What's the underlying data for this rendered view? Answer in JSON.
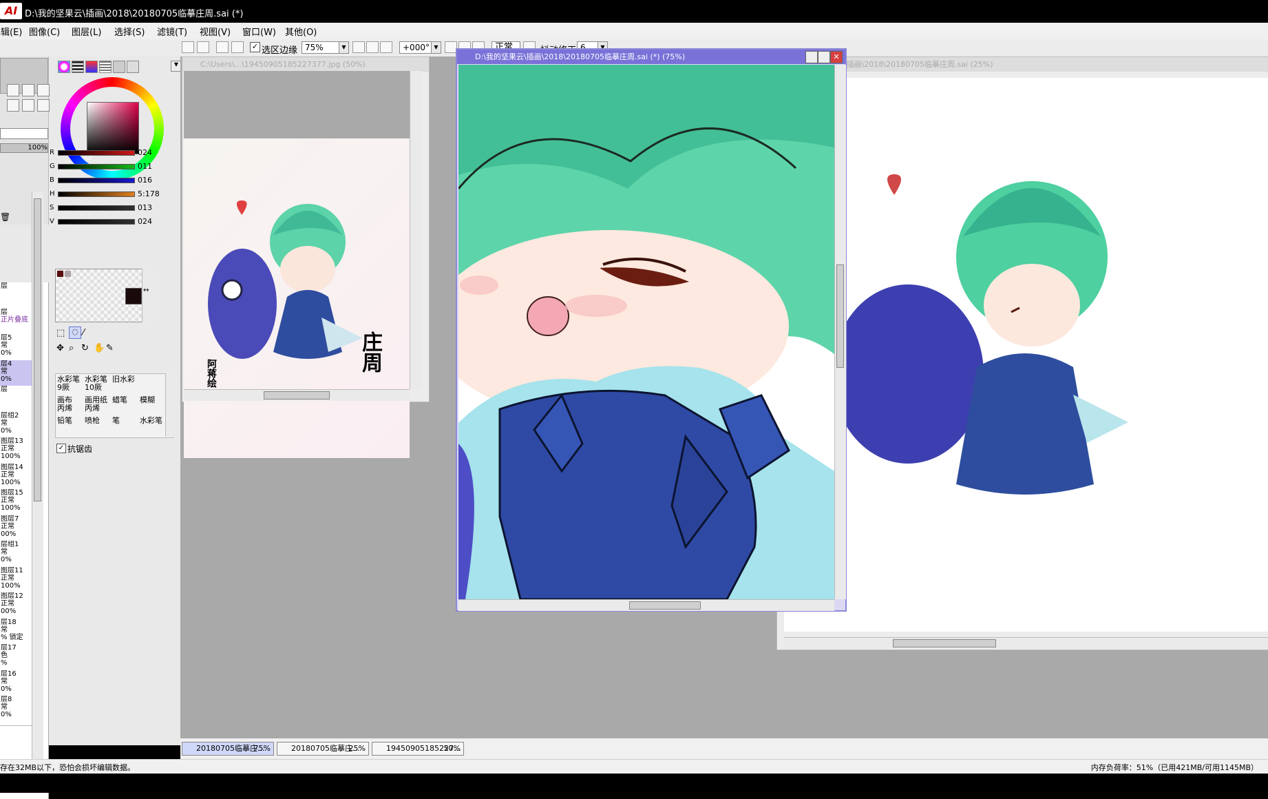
{
  "window": {
    "logo": "AI",
    "title": "D:\\我的坚果云\\插画\\2018\\20180705临摹庄周.sai (*)"
  },
  "menu": [
    "编辑(E)",
    "图像(C)",
    "图层(L)",
    "选择(S)",
    "滤镜(T)",
    "视图(V)",
    "窗口(W)",
    "其他(O)"
  ],
  "toolbar": {
    "selection_edge_label": "选区边缘",
    "zoom": "75%",
    "rotation": "+000°",
    "blend_mode": "正常",
    "stabilizer_label": "抖动修正",
    "stabilizer_value": "6"
  },
  "color_panel": {
    "current_color": "#1a0a0c",
    "sliders": [
      {
        "label": "R",
        "value": "024",
        "color": "#d01818"
      },
      {
        "label": "G",
        "value": "011",
        "color": "#18b818"
      },
      {
        "label": "B",
        "value": "016",
        "color": "#1818d0"
      },
      {
        "label": "H",
        "value": "5:178",
        "color": "#e08020"
      },
      {
        "label": "S",
        "value": "013",
        "color": "#303030"
      },
      {
        "label": "V",
        "value": "024",
        "color": "#303030"
      }
    ],
    "opacity": "100%"
  },
  "brushes": [
    [
      "水彩笔\n9厥",
      "水彩笔\n10厥",
      "旧水彩"
    ],
    [
      "画布\n丙烯",
      "画用纸\n丙烯",
      "蜡笔",
      "模糊"
    ],
    [
      "铅笔",
      "喷枪",
      "笔",
      "水彩笔"
    ]
  ],
  "antialias_label": "抗锯齿",
  "layers": [
    {
      "name": "层",
      "mode": "",
      "opacity": ""
    },
    {
      "name": "层",
      "mode": "正片叠底",
      "opacity": ""
    },
    {
      "name": "层5",
      "mode": "常",
      "opacity": "0%"
    },
    {
      "name": "层4",
      "mode": "常",
      "opacity": "0%",
      "selected": true
    },
    {
      "name": "层",
      "mode": "",
      "opacity": ""
    },
    {
      "name": "层组2",
      "mode": "常",
      "opacity": "0%"
    },
    {
      "name": "图层13",
      "mode": "正常",
      "opacity": "100%"
    },
    {
      "name": "图层14",
      "mode": "正常",
      "opacity": "100%"
    },
    {
      "name": "图层15",
      "mode": "正常",
      "opacity": "100%"
    },
    {
      "name": "图层7",
      "mode": "正常",
      "opacity": "00%"
    },
    {
      "name": "层组1",
      "mode": "常",
      "opacity": "0%"
    },
    {
      "name": "图层11",
      "mode": "正常",
      "opacity": "100%"
    },
    {
      "name": "图层12",
      "mode": "正常",
      "opacity": "00%"
    },
    {
      "name": "层18",
      "mode": "常",
      "opacity": "% 锁定"
    },
    {
      "name": "层17",
      "mode": "色",
      "opacity": "%"
    },
    {
      "name": "层16",
      "mode": "常",
      "opacity": "0%"
    },
    {
      "name": "层8",
      "mode": "常",
      "opacity": "0%"
    }
  ],
  "documents": {
    "reference": {
      "title": "C:\\Users\\...\\19450905185227377.jpg (50%)",
      "signature": "阿蒋绘",
      "name_art": "庄周"
    },
    "main": {
      "title": "D:\\我的坚果云\\插画\\2018\\20180705临摹庄周.sai (*) (75%)"
    },
    "overview": {
      "title": "D:\\我的坚果云\\插画\\2018\\20180705临摹庄周.sai (25%)"
    }
  },
  "tabs": [
    {
      "label": "20180705临摹庄...",
      "zoom": "75%",
      "active": true
    },
    {
      "label": "20180705临摹庄...",
      "zoom": "25%",
      "active": false
    },
    {
      "label": "19450905185227...",
      "zoom": "50%",
      "active": false
    }
  ],
  "status": {
    "left": "存在32MB以下，恐怕会损坏编辑数据。",
    "right": "内存负荷率：51%（已用421MB/可用1145MB）"
  }
}
